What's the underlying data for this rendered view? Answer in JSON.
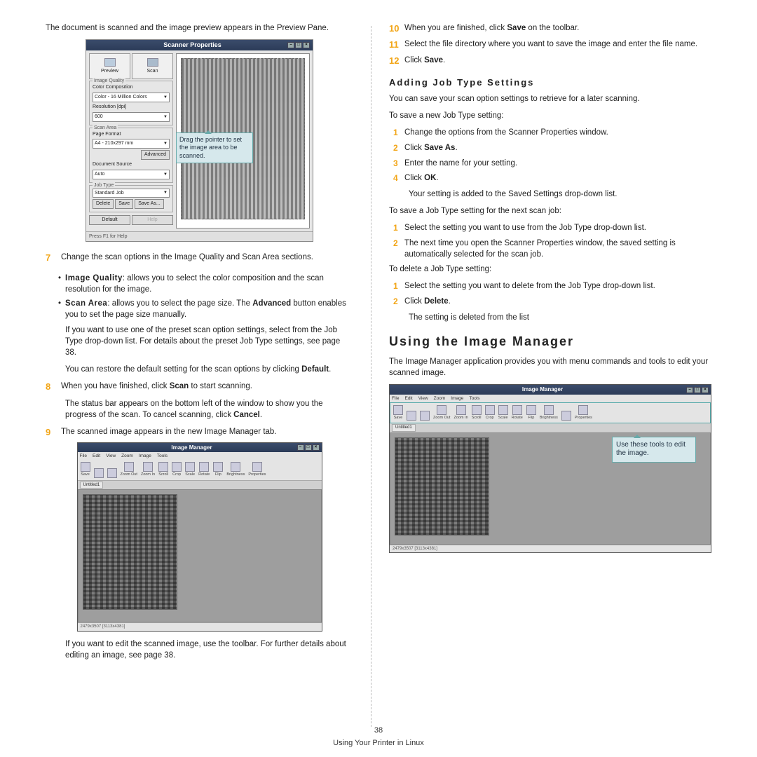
{
  "left": {
    "intro": "The document is scanned and the image preview appears in the Preview Pane.",
    "step7": {
      "num": "7",
      "text": "Change the scan options in the Image Quality and Scan Area sections.",
      "bullets": [
        {
          "term": "Image Quality",
          "desc": ": allows you to select the color composition and the scan resolution for the image."
        },
        {
          "term": "Scan Area",
          "desc": ": allows you to select the page size. The ",
          "term2": "Advanced",
          "desc2": " button enables you to set the page size manually."
        }
      ],
      "p1": "If you want to use one of the preset scan option settings, select from the Job Type drop-down list. For details about the preset Job Type settings, see page 38.",
      "p2_a": "You can restore the default setting for the scan options by clicking ",
      "p2_b": "Default",
      "p2_c": "."
    },
    "step8": {
      "num": "8",
      "text_a": "When you have finished, click ",
      "text_b": "Scan",
      "text_c": " to start scanning.",
      "p1_a": "The status bar appears on the bottom left of the window to show you the progress of the scan. To cancel scanning, click ",
      "p1_b": "Cancel",
      "p1_c": "."
    },
    "step9": {
      "num": "9",
      "text": "The scanned image appears in the new Image Manager tab.",
      "tail": "If you want to edit the scanned image, use the toolbar. For further details about editing an image, see page 38."
    },
    "callout": "Drag the pointer to set the image area to be scanned."
  },
  "right": {
    "step10": {
      "num": "10",
      "a": "When you are finished, click ",
      "b": "Save",
      "c": " on the toolbar."
    },
    "step11": {
      "num": "11",
      "text": "Select the file directory where you want to save the image and enter the file name."
    },
    "step12": {
      "num": "12",
      "a": "Click ",
      "b": "Save",
      "c": "."
    },
    "h2": "Adding Job Type Settings",
    "p1": "You can save your scan option settings to retrieve for a later scanning.",
    "saveNew": "To save a new Job Type setting:",
    "sn": [
      {
        "n": "1",
        "t": "Change the options from the Scanner Properties window."
      },
      {
        "n": "2",
        "a": "Click ",
        "b": "Save As",
        "c": "."
      },
      {
        "n": "3",
        "t": "Enter the name for your setting."
      },
      {
        "n": "4",
        "a": "Click ",
        "b": "OK",
        "c": "."
      }
    ],
    "snTail": "Your setting is added to the Saved Settings drop-down list.",
    "saveNext": "To save a Job Type setting for the next scan job:",
    "sx": [
      {
        "n": "1",
        "t": "Select the setting you want to use from the Job Type drop-down list."
      },
      {
        "n": "2",
        "t": "The next time you open the Scanner Properties window, the saved setting is automatically selected for the scan job."
      }
    ],
    "delIntro": "To delete a Job Type setting:",
    "dl": [
      {
        "n": "1",
        "t": "Select the setting you want to delete from the Job Type drop-down list."
      },
      {
        "n": "2",
        "a": "Click ",
        "b": "Delete",
        "c": "."
      }
    ],
    "dlTail": "The setting is deleted from the list",
    "h1": "Using the Image Manager",
    "imIntro": "The Image Manager application provides you with menu commands and tools to edit your scanned image.",
    "imCallout": "Use these tools to edit the image."
  },
  "scanner": {
    "title": "Scanner Properties",
    "tabs": {
      "preview": "Preview",
      "scan": "Scan"
    },
    "imageQuality": {
      "legend": "Image Quality",
      "colorComp": "Color Composition",
      "colorVal": "Color - 16 Million Colors",
      "resLabel": "Resolution [dpi]",
      "resVal": "600"
    },
    "scanArea": {
      "legend": "Scan Area",
      "pageFormat": "Page Format",
      "pageVal": "A4 - 210x297 mm",
      "advanced": "Advanced",
      "docSource": "Document Source",
      "docVal": "Auto"
    },
    "jobType": {
      "legend": "Job Type",
      "val": "Standard Job",
      "delete": "Delete",
      "save": "Save",
      "saveAs": "Save As..."
    },
    "default": "Default",
    "help": "Help",
    "status": "Press F1 for Help"
  },
  "imageManager": {
    "title": "Image Manager",
    "menus": [
      "File",
      "Edit",
      "View",
      "Zoom",
      "Image",
      "Tools"
    ],
    "tools": [
      "Save",
      "",
      "",
      "Zoom Out",
      "Zoom In",
      "Scroll",
      "Crop",
      "Scale",
      "Rotate",
      "Flip",
      "Brightness",
      "",
      "Properties"
    ],
    "tab": "Untitled1",
    "status": "2479x3507 [3113x4381]"
  },
  "footer": {
    "page": "38",
    "caption": "Using Your Printer in Linux"
  }
}
